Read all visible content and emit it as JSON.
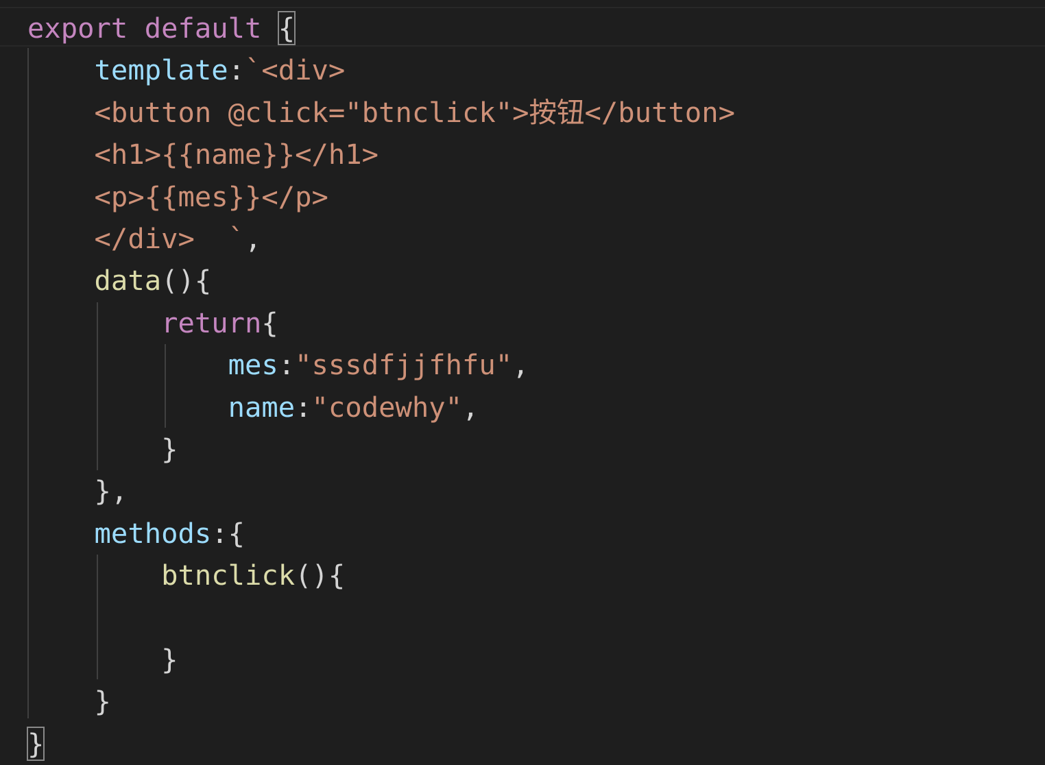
{
  "editor": {
    "theme_colors": {
      "background": "#1e1e1e",
      "keyword": "#c586c0",
      "property": "#9cdcfe",
      "string": "#ce9178",
      "function": "#dcdcaa",
      "punctuation": "#d4d4d4"
    },
    "lines": [
      {
        "export": "export",
        "default": "default",
        "brace": "{"
      },
      {
        "prop": "template",
        "colon": ":",
        "str": "`<div>"
      },
      {
        "str": "<button @click=\"btnclick\">按钮</button>"
      },
      {
        "str": "<h1>{{name}}</h1>"
      },
      {
        "str": "<p>{{mes}}</p>"
      },
      {
        "str": "</div>  `",
        "punc": ","
      },
      {
        "fn": "data",
        "punc": "(){"
      },
      {
        "kw": "return",
        "punc": "{"
      },
      {
        "prop": "mes",
        "colon": ":",
        "str": "\"sssdfjjfhfu\"",
        "punc": ","
      },
      {
        "prop": "name",
        "colon": ":",
        "str": "\"codewhy\"",
        "punc": ","
      },
      {
        "punc": "}"
      },
      {
        "punc": "},"
      },
      {
        "prop": "methods",
        "punc": ":{"
      },
      {
        "fn": "btnclick",
        "punc": "(){"
      },
      {
        "text": ""
      },
      {
        "punc": "}"
      },
      {
        "punc": "}"
      },
      {
        "punc": "}"
      }
    ]
  }
}
